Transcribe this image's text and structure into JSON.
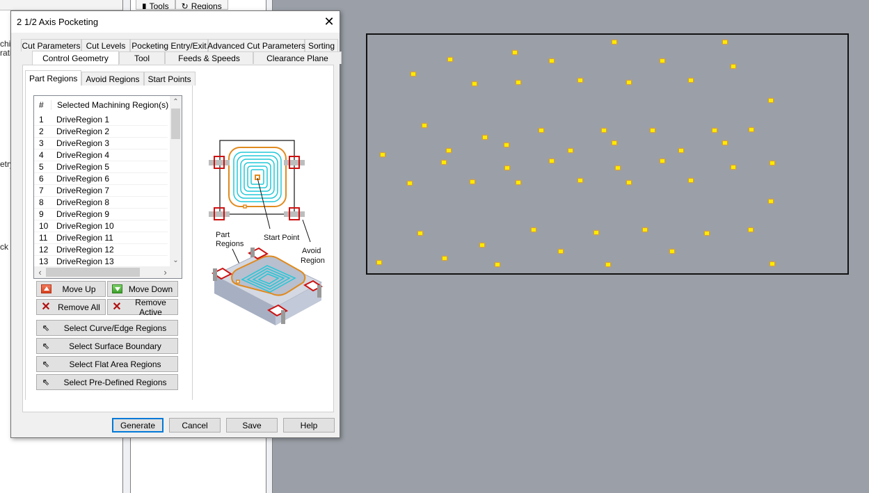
{
  "background_app": {
    "ribbon_tabs": [
      {
        "icon": "tools-icon",
        "label": "Tools"
      },
      {
        "icon": "regions-icon",
        "label": "Regions"
      }
    ],
    "left_panel_fragments": [
      "chi",
      "rati",
      "etry",
      "ck"
    ]
  },
  "dialog": {
    "title": "2 1/2 Axis Pocketing",
    "close_label": "✕",
    "tabs_row1": [
      "Cut Parameters",
      "Cut Levels",
      "Pocketing Entry/Exit",
      "Advanced Cut Parameters",
      "Sorting"
    ],
    "tabs_row2": [
      "Control Geometry",
      "Tool",
      "Feeds & Speeds",
      "Clearance Plane"
    ],
    "active_tab": "Control Geometry",
    "subtabs": [
      "Part Regions",
      "Avoid Regions",
      "Start Points"
    ],
    "active_subtab": "Part Regions",
    "list": {
      "header_num": "#",
      "header_name": "Selected Machining Region(s)",
      "rows": [
        {
          "num": "1",
          "name": "DriveRegion 1"
        },
        {
          "num": "2",
          "name": "DriveRegion 2"
        },
        {
          "num": "3",
          "name": "DriveRegion 3"
        },
        {
          "num": "4",
          "name": "DriveRegion 4"
        },
        {
          "num": "5",
          "name": "DriveRegion 5"
        },
        {
          "num": "6",
          "name": "DriveRegion 6"
        },
        {
          "num": "7",
          "name": "DriveRegion 7"
        },
        {
          "num": "8",
          "name": "DriveRegion 8"
        },
        {
          "num": "9",
          "name": "DriveRegion 9"
        },
        {
          "num": "10",
          "name": "DriveRegion 10"
        },
        {
          "num": "11",
          "name": "DriveRegion 11"
        },
        {
          "num": "12",
          "name": "DriveRegion 12"
        },
        {
          "num": "13",
          "name": "DriveRegion 13"
        }
      ],
      "scroll_up": "⌃",
      "scroll_down": "⌄",
      "scroll_left": "‹",
      "scroll_right": "›"
    },
    "buttons": {
      "move_up": "Move Up",
      "move_down": "Move Down",
      "remove_all": "Remove All",
      "remove_active": "Remove Active",
      "select_curve": "Select Curve/Edge Regions",
      "select_surface": "Select Surface Boundary",
      "select_flat": "Select Flat Area Regions",
      "select_predefined": "Select Pre-Defined Regions"
    },
    "icons": {
      "x": "✕",
      "cursor": "⇖"
    },
    "diagram": {
      "label_part_regions_1": "Part",
      "label_part_regions_2": "Regions",
      "label_start_point": "Start Point",
      "label_avoid_1": "Avoid",
      "label_avoid_2": "Region",
      "colors": {
        "toolpath": "#21c8d8",
        "boundary": "#e08a1e",
        "avoid": "#cc1111",
        "clamp": "#b9b9b9"
      }
    },
    "footer": {
      "generate": "Generate",
      "cancel": "Cancel",
      "save": "Save",
      "help": "Help"
    }
  },
  "viewport": {
    "background": "#9ba0a8",
    "point_color": "#ffeb00",
    "point_count": 52
  }
}
